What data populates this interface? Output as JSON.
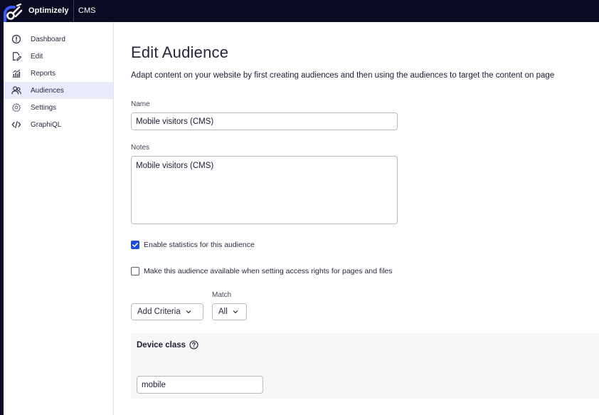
{
  "topbar": {
    "brand": "Optimizely",
    "product": "CMS"
  },
  "sidebar": {
    "items": [
      {
        "label": "Dashboard",
        "icon": "dashboard-icon",
        "active": false
      },
      {
        "label": "Edit",
        "icon": "edit-icon",
        "active": false
      },
      {
        "label": "Reports",
        "icon": "reports-icon",
        "active": false
      },
      {
        "label": "Audiences",
        "icon": "audiences-icon",
        "active": true
      },
      {
        "label": "Settings",
        "icon": "gear-icon",
        "active": false
      },
      {
        "label": "GraphiQL",
        "icon": "code-icon",
        "active": false
      }
    ]
  },
  "main": {
    "title": "Edit Audience",
    "description": "Adapt content on your website by first creating audiences and then using the audiences to target the content on page",
    "name": {
      "label": "Name",
      "value": "Mobile visitors (CMS)"
    },
    "notes": {
      "label": "Notes",
      "value": "Mobile visitors (CMS)"
    },
    "enable_statistics": {
      "label": "Enable statistics for this audience",
      "checked": true
    },
    "access_rights": {
      "label": "Make this audience available when setting access rights for pages and files",
      "checked": false
    },
    "add_criteria": {
      "label": "Add Criteria"
    },
    "match": {
      "label": "Match",
      "value": "All"
    },
    "criteria": {
      "title": "Device class",
      "value": "mobile"
    }
  },
  "colors": {
    "topbar_bg": "#0b0b23",
    "accent": "#1f4ed8",
    "active_nav_bg": "#e8ebfb"
  }
}
